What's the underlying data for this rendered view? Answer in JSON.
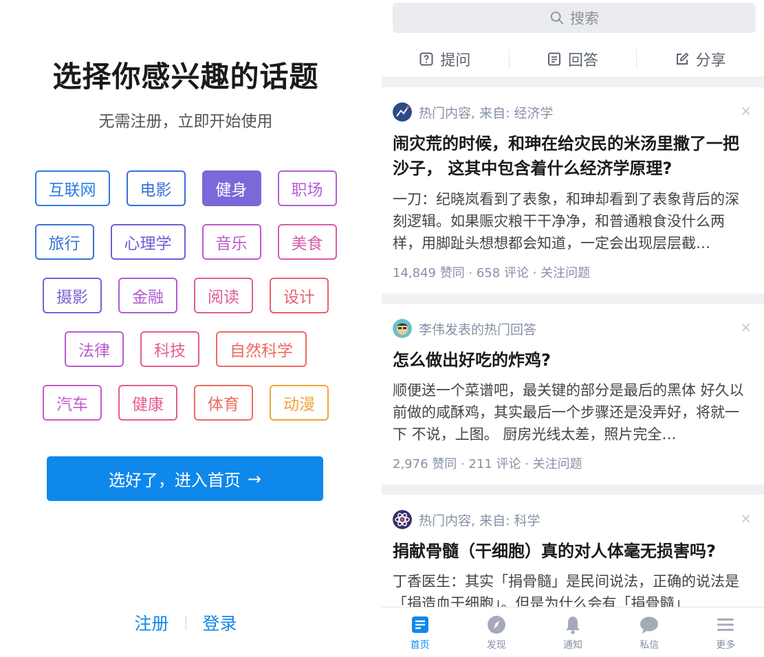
{
  "left": {
    "title": "选择你感兴趣的话题",
    "subtitle": "无需注册，立即开始使用",
    "topic_rows": [
      [
        {
          "label": "互联网",
          "color": "#2a7de1",
          "selected": false
        },
        {
          "label": "电影",
          "color": "#3a6fd8",
          "selected": false
        },
        {
          "label": "健身",
          "color": "#7b68d9",
          "selected": true
        },
        {
          "label": "职场",
          "color": "#b45fd6",
          "selected": false
        }
      ],
      [
        {
          "label": "旅行",
          "color": "#3a72d8",
          "selected": false
        },
        {
          "label": "心理学",
          "color": "#6b5fd6",
          "selected": false
        },
        {
          "label": "音乐",
          "color": "#c05ac8",
          "selected": false
        },
        {
          "label": "美食",
          "color": "#d85aa8",
          "selected": false
        }
      ],
      [
        {
          "label": "摄影",
          "color": "#7a5fd4",
          "selected": false
        },
        {
          "label": "金融",
          "color": "#b25ccd",
          "selected": false
        },
        {
          "label": "阅读",
          "color": "#e05b9a",
          "selected": false
        },
        {
          "label": "设计",
          "color": "#ea6070",
          "selected": false
        }
      ],
      [
        {
          "label": "法律",
          "color": "#b85ccc",
          "selected": false
        },
        {
          "label": "科技",
          "color": "#e45b96",
          "selected": false
        },
        {
          "label": "自然科学",
          "color": "#ee6a5e",
          "selected": false
        }
      ],
      [
        {
          "label": "汽车",
          "color": "#c45cc6",
          "selected": false
        },
        {
          "label": "健康",
          "color": "#e45b92",
          "selected": false
        },
        {
          "label": "体育",
          "color": "#ee6a5e",
          "selected": false
        },
        {
          "label": "动漫",
          "color": "#f0a33a",
          "selected": false
        }
      ]
    ],
    "enter_button": "选好了，进入首页",
    "enter_arrow": "→",
    "register": "注册",
    "login": "登录"
  },
  "right": {
    "search_placeholder": "搜索",
    "actions": [
      {
        "label": "提问",
        "icon": "question-box-icon"
      },
      {
        "label": "回答",
        "icon": "answer-doc-icon"
      },
      {
        "label": "分享",
        "icon": "share-pen-icon"
      }
    ],
    "cards": [
      {
        "source": "热门内容, 来自: 经济学",
        "title": "闹灾荒的时候，和珅在给灾民的米汤里撒了一把沙子， 这其中包含着什么经济学原理?",
        "excerpt": "一刀：纪晓岚看到了表象，和珅却看到了表象背后的深刻逻辑。如果赈灾粮干干净净，和普通粮食没什么两样，用脚趾头想想都会知道，一定会出现层层截…",
        "meta": "14,849 赞同 · 658 评论 · 关注问题",
        "close": "×"
      },
      {
        "source": "李伟发表的热门回答",
        "title": "怎么做出好吃的炸鸡?",
        "excerpt": "顺便送一个菜谱吧，最关键的部分是最后的黑体 好久以前做的咸酥鸡，其实最后一个步骤还是没弄好，将就一下 不说，上图。 厨房光线太差，照片完全…",
        "meta": "2,976 赞同 · 211 评论 · 关注问题",
        "close": "×"
      },
      {
        "source": "热门内容, 来自: 科学",
        "title": "捐献骨髓（干细胞）真的对人体毫无损害吗?",
        "excerpt": "丁香医生：其实「捐骨髓」是民间说法，正确的说法是「捐造血干细胞」。但是为什么会有「捐骨髓」",
        "meta": "",
        "close": "×"
      }
    ],
    "tabs": [
      {
        "label": "首页",
        "icon": "home-icon",
        "active": true
      },
      {
        "label": "发现",
        "icon": "compass-icon",
        "active": false
      },
      {
        "label": "通知",
        "icon": "bell-icon",
        "active": false
      },
      {
        "label": "私信",
        "icon": "chat-icon",
        "active": false
      },
      {
        "label": "更多",
        "icon": "menu-icon",
        "active": false
      }
    ]
  },
  "colors": {
    "brand_blue": "#0f88eb",
    "feed_bg": "#f0f1f3",
    "meta_gray": "#8590a6"
  }
}
